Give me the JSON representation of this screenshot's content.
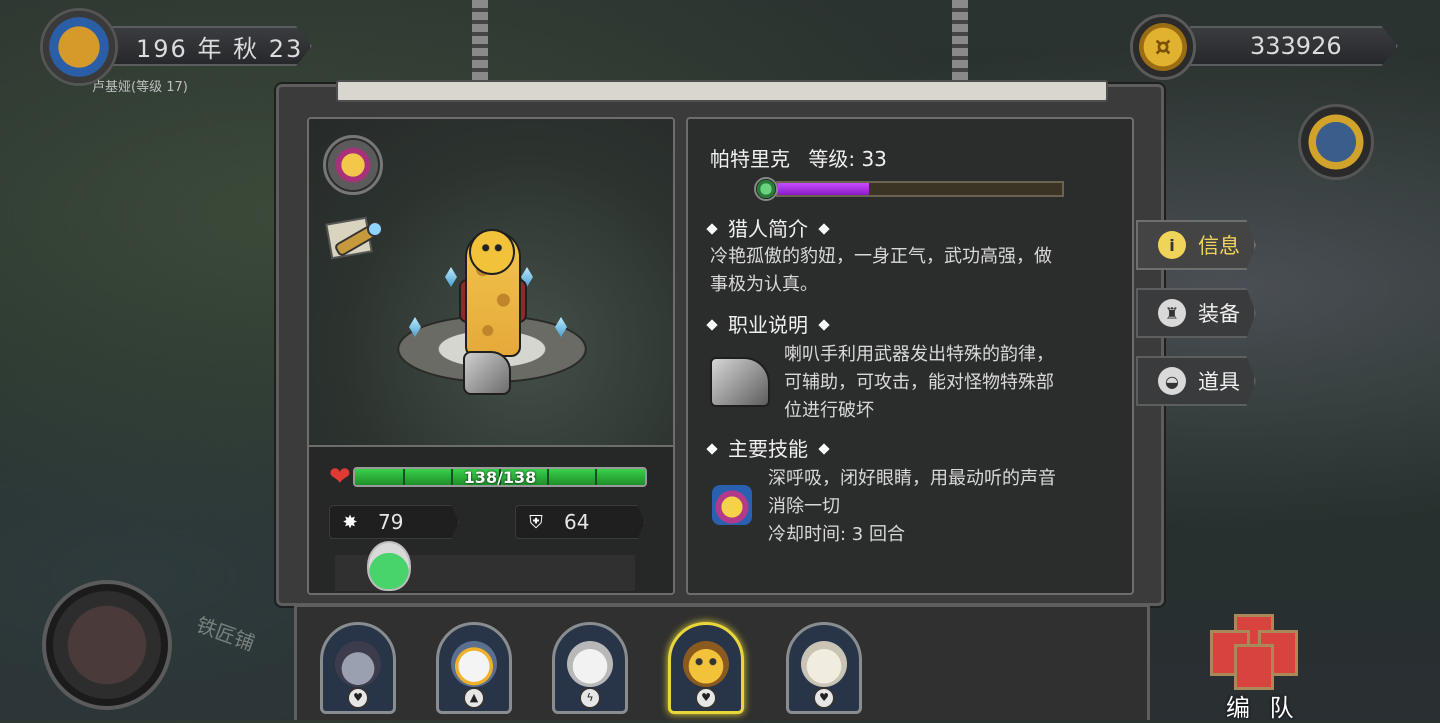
{
  "top_bar": {
    "date": "196 年 秋 23",
    "player_name": "卢基娅(等级 17)",
    "gold": "333926"
  },
  "character": {
    "name": "帕特里克",
    "level_label": "等级: 33",
    "xp_fraction": 0.32,
    "hp_text": "138/138",
    "hp_fraction": 1.0,
    "attack": "79",
    "defense": "64"
  },
  "sections": {
    "intro_title": "猎人简介",
    "intro_text_1": "冷艳孤傲的豹妞，一身正气，武功高强，做",
    "intro_text_2": "事极为认真。",
    "class_title": "职业说明",
    "class_text_1": "喇叭手利用武器发出特殊的韵律，",
    "class_text_2": "可辅助，可攻击，能对怪物特殊部",
    "class_text_3": "位进行破坏",
    "skill_title": "主要技能",
    "skill_text_1": "深呼吸，闭好眼睛，用最动听的声音",
    "skill_text_2": "消除一切",
    "skill_cooldown": "冷却时间: 3 回合"
  },
  "tabs": [
    {
      "label": "信息",
      "icon": "info-icon",
      "active": true
    },
    {
      "label": "装备",
      "icon": "armor-icon",
      "active": false
    },
    {
      "label": "道具",
      "icon": "pouch-icon",
      "active": false
    }
  ],
  "team": {
    "button_label": "编 队",
    "members": [
      {
        "icon": "pirate-portrait",
        "active": false
      },
      {
        "icon": "eagle-portrait",
        "active": false
      },
      {
        "icon": "polar-bear-portrait",
        "active": false
      },
      {
        "icon": "leopard-portrait",
        "active": true
      },
      {
        "icon": "white-hair-portrait",
        "active": false
      }
    ]
  },
  "colors": {
    "hp": "#2fbf45",
    "xp": "#b03ee8",
    "active_tab_text": "#f0d45a",
    "active_portrait": "#e9d63a"
  }
}
